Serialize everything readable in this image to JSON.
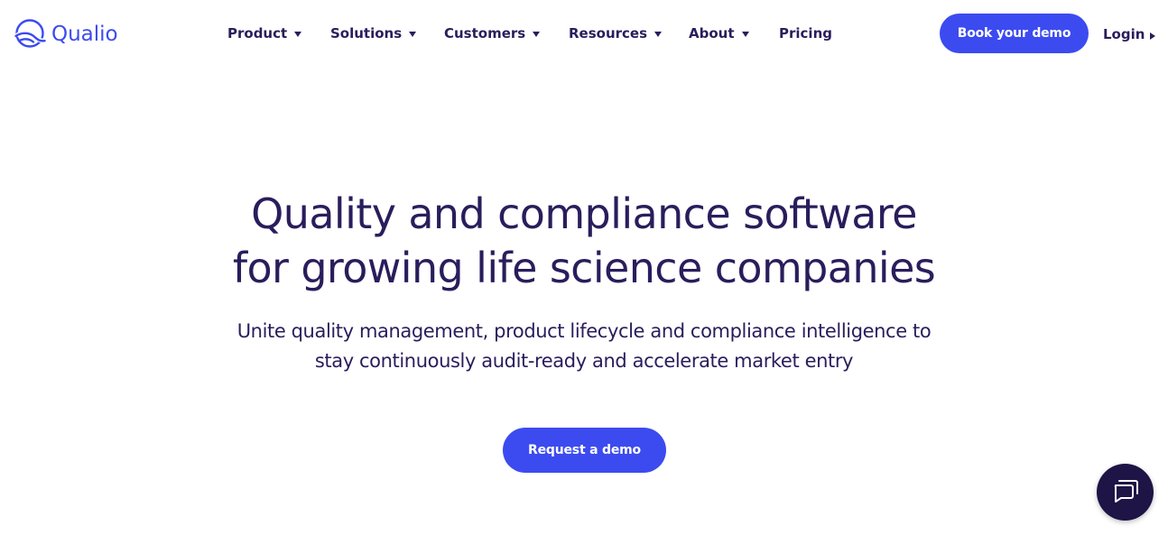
{
  "brand": {
    "name": "Qualio",
    "logo_icon": "qualio-logo-icon",
    "accent_color": "#3c4bef",
    "text_color": "#2a1d5c",
    "chat_color": "#1e1446"
  },
  "nav": {
    "items": [
      {
        "label": "Product",
        "has_dropdown": true
      },
      {
        "label": "Solutions",
        "has_dropdown": true
      },
      {
        "label": "Customers",
        "has_dropdown": true
      },
      {
        "label": "Resources",
        "has_dropdown": true
      },
      {
        "label": "About",
        "has_dropdown": true
      },
      {
        "label": "Pricing",
        "has_dropdown": false
      }
    ],
    "dropdown_icon": "caret-down-icon"
  },
  "header": {
    "book_demo_label": "Book your demo",
    "login_label": "Login",
    "login_icon": "caret-right-icon"
  },
  "hero": {
    "title_line1": "Quality and compliance software",
    "title_line2": "for growing life science companies",
    "subtitle_line1": "Unite quality management, product lifecycle and compliance intelligence to",
    "subtitle_line2": "stay continuously audit-ready and accelerate market entry",
    "cta_label": "Request a demo"
  },
  "chat": {
    "icon": "chat-bubbles-icon"
  }
}
